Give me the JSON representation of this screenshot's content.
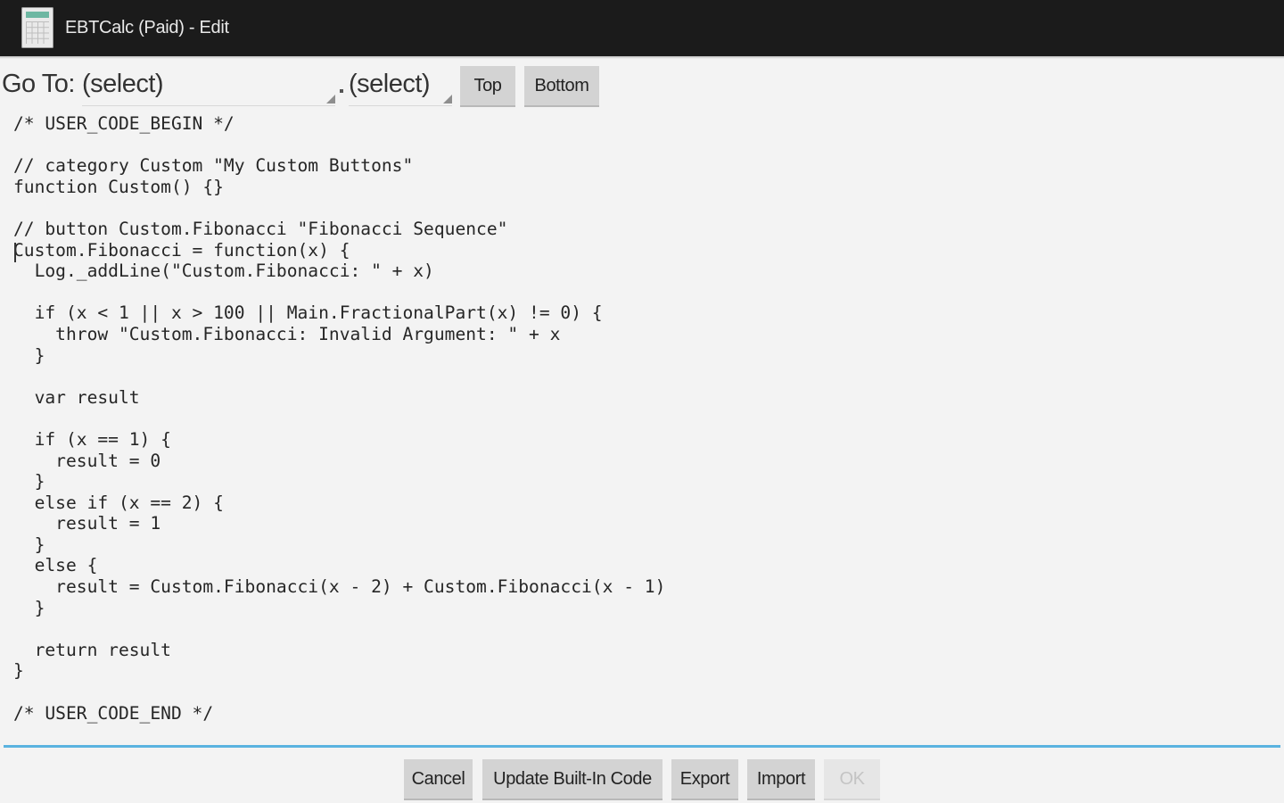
{
  "window": {
    "title": "EBTCalc (Paid) - Edit",
    "icon": "calculator-icon"
  },
  "goto": {
    "label": "Go To:",
    "category_select": "(select)",
    "function_select": "(select)",
    "top_button": "Top",
    "bottom_button": "Bottom"
  },
  "editor": {
    "code": "/* USER_CODE_BEGIN */\n\n// category Custom \"My Custom Buttons\"\nfunction Custom() {}\n\n// button Custom.Fibonacci \"Fibonacci Sequence\"\nCustom.Fibonacci = function(x) {\n  Log._addLine(\"Custom.Fibonacci: \" + x)\n\n  if (x < 1 || x > 100 || Main.FractionalPart(x) != 0) {\n    throw \"Custom.Fibonacci: Invalid Argument: \" + x\n  }\n\n  var result\n\n  if (x == 1) {\n    result = 0\n  }\n  else if (x == 2) {\n    result = 1\n  }\n  else {\n    result = Custom.Fibonacci(x - 2) + Custom.Fibonacci(x - 1)\n  }\n\n  return result\n}\n\n/* USER_CODE_END */"
  },
  "actions": {
    "cancel": "Cancel",
    "update_builtin": "Update Built-In Code",
    "export": "Export",
    "import": "Import",
    "ok": "OK"
  },
  "colors": {
    "title_bar": "#1b1b1b",
    "background": "#f3f3f3",
    "button": "#d3d3d3",
    "editor_focus_line": "#5ab3e0"
  }
}
